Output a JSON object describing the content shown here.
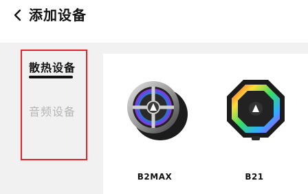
{
  "header": {
    "title": "添加设备"
  },
  "sidebar": {
    "tabs": [
      {
        "label": "散热设备"
      },
      {
        "label": "音频设备"
      }
    ]
  },
  "devices": [
    {
      "name": "B2MAX"
    },
    {
      "name": "B21"
    }
  ]
}
